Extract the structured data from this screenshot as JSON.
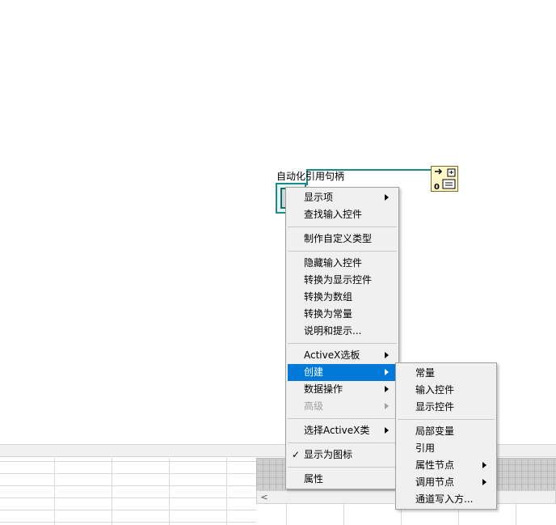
{
  "diagram": {
    "control_label": "自动化引用句柄",
    "refnum_icon": "automation-refnum-icon",
    "invoke_icon": "invoke-node-icon",
    "wire_color": "#1a8a8a"
  },
  "context_menu": {
    "items": [
      {
        "label": "显示项",
        "submenu": true
      },
      {
        "label": "查找输入控件",
        "submenu": false
      },
      {
        "label": "制作自定义类型",
        "submenu": false
      },
      {
        "label": "隐藏输入控件",
        "submenu": false
      },
      {
        "label": "转换为显示控件",
        "submenu": false
      },
      {
        "label": "转换为数组",
        "submenu": false
      },
      {
        "label": "转换为常量",
        "submenu": false
      },
      {
        "label": "说明和提示...",
        "submenu": false
      },
      {
        "label": "ActiveX选板",
        "submenu": true
      },
      {
        "label": "创建",
        "submenu": true,
        "selected": true
      },
      {
        "label": "数据操作",
        "submenu": true
      },
      {
        "label": "高级",
        "submenu": true,
        "disabled": true
      },
      {
        "label": "选择ActiveX类",
        "submenu": true
      },
      {
        "label": "显示为图标",
        "checked": true,
        "check_mark": "✓"
      },
      {
        "label": "属性",
        "submenu": false
      }
    ]
  },
  "create_submenu": {
    "items": [
      {
        "label": "常量"
      },
      {
        "label": "输入控件"
      },
      {
        "label": "显示控件"
      },
      {
        "label": "局部变量"
      },
      {
        "label": "引用"
      },
      {
        "label": "属性节点",
        "submenu": true
      },
      {
        "label": "调用节点",
        "submenu": true
      },
      {
        "label": "通道写入方..."
      }
    ]
  },
  "scrollbar": {
    "left_arrow": "<"
  },
  "colors": {
    "selection": "#0078d7",
    "menu_bg": "#f0f0f0"
  }
}
